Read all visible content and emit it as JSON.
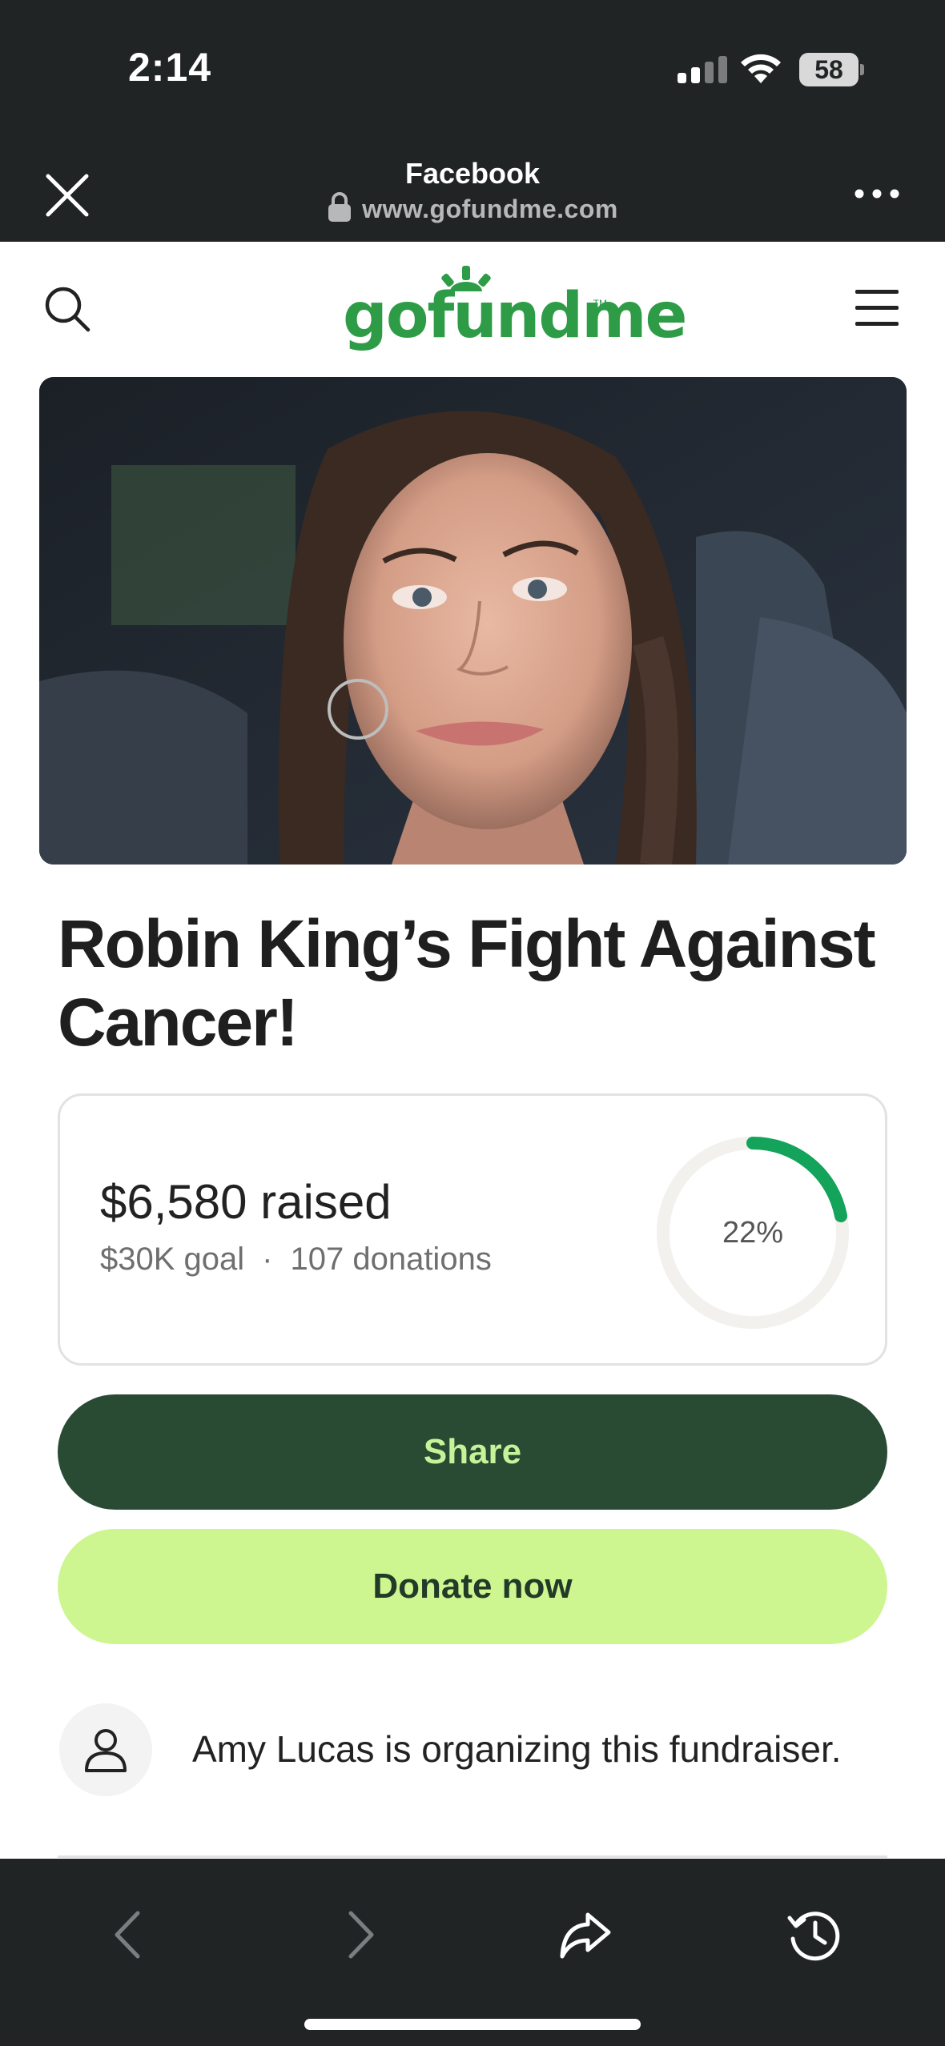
{
  "status_bar": {
    "time": "2:14",
    "battery": "58"
  },
  "browser": {
    "source_title": "Facebook",
    "url": "www.gofundme.com",
    "icons": [
      "close-icon",
      "lock-icon",
      "more-icon"
    ]
  },
  "site_header": {
    "logo_text": "gofundme",
    "logo_tm": "TM",
    "icons": [
      "search-icon",
      "hamburger-menu-icon"
    ],
    "brand_color": "#2e9c47"
  },
  "campaign": {
    "title": "Robin King’s Fight Against Cancer!",
    "raised": "$6,580 raised",
    "goal": "$30K goal",
    "separator": "·",
    "donations": "107 donations",
    "progress_label": "22%",
    "progress_fraction": 0.22,
    "progress_color": "#13a35b"
  },
  "actions": {
    "share_label": "Share",
    "donate_label": "Donate now"
  },
  "organizer": {
    "text": "Amy Lucas is organizing this fundraiser.",
    "icon": "person-icon"
  },
  "browser_toolbar": {
    "icons": [
      "back-icon",
      "forward-icon",
      "share-icon",
      "history-icon"
    ]
  }
}
